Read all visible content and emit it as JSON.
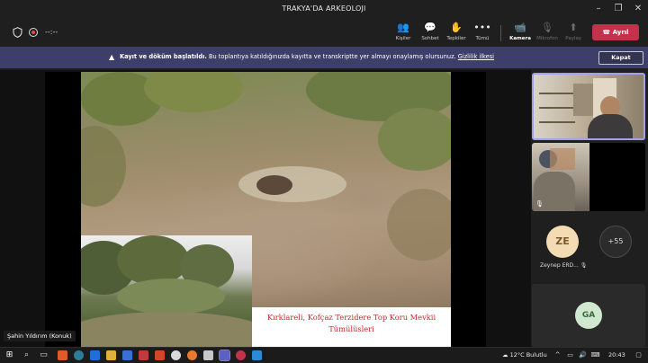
{
  "window": {
    "title": "TRAKYA'DA ARKEOLOJI",
    "minimize_icon": "minimize-icon",
    "maximize_icon": "maximize-icon",
    "close_icon": "close-icon"
  },
  "toolbar": {
    "timer": "--:--",
    "buttons": [
      {
        "label": "Kişiler",
        "icon": "people-icon"
      },
      {
        "label": "Sohbet",
        "icon": "chat-icon"
      },
      {
        "label": "Tepkiler",
        "icon": "reactions-icon"
      },
      {
        "label": "Tümü",
        "icon": "more-icon"
      },
      {
        "label": "Kamera",
        "icon": "camera-icon"
      },
      {
        "label": "Mikrofon",
        "icon": "microphone-icon"
      },
      {
        "label": "Paylaş",
        "icon": "share-icon"
      }
    ],
    "leave_label": "Ayrıl"
  },
  "banner": {
    "bold_text": "Kayıt ve döküm başlatıldı.",
    "text": "Bu toplantıya katıldığınızda kayıtta ve transkriptte yer almayı onaylamış olursunuz.",
    "link_text": "Gizlilik ilkesi",
    "close_label": "Kapat"
  },
  "stage": {
    "caption_line1": "Kırklareli, Kofçaz Terzidere Top Koru Mevkii",
    "caption_line2": "Tümülüsleri",
    "presenter": "Şahin Yıldırım (Konuk)"
  },
  "participants": {
    "ze_initials": "ZE",
    "ze_name": "Zeynep ERD...",
    "more_count": "+55",
    "ga_initials": "GA"
  },
  "taskbar": {
    "weather": "12°C  Bulutlu",
    "time": "20:43"
  }
}
